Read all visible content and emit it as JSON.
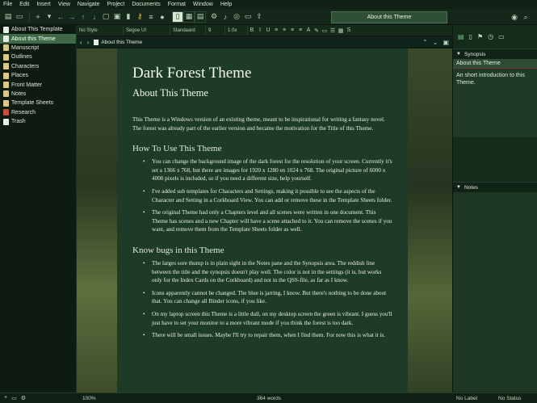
{
  "menu": [
    "File",
    "Edit",
    "Insert",
    "View",
    "Navigate",
    "Project",
    "Documents",
    "Format",
    "Window",
    "Help"
  ],
  "toolbar": {
    "title_tab": "About this Theme"
  },
  "binder": {
    "items": [
      {
        "label": "About This Template",
        "type": "doc"
      },
      {
        "label": "About this Theme",
        "type": "doc",
        "selected": true
      },
      {
        "label": "Manuscript",
        "type": "folder"
      },
      {
        "label": "Outlines",
        "type": "folder"
      },
      {
        "label": "Characters",
        "type": "folder"
      },
      {
        "label": "Places",
        "type": "folder"
      },
      {
        "label": "Front Matter",
        "type": "folder"
      },
      {
        "label": "Notes",
        "type": "folder"
      },
      {
        "label": "Template Sheets",
        "type": "folder"
      },
      {
        "label": "Research",
        "type": "folder"
      },
      {
        "label": "Trash",
        "type": "trash"
      }
    ]
  },
  "formatbar": {
    "style": "No Style",
    "font": "Segoe UI",
    "weight": "Standaard",
    "size": "9",
    "line_spacing": "1.0x"
  },
  "header": {
    "doc_title": "About this Theme"
  },
  "document": {
    "h1": "Dark Forest Theme",
    "h2": "About This Theme",
    "intro": "This Theme is a Windows version of an existing theme, meant to be inspirational for writing a fantasy novel. The forest was already part of the earlier version and became the motivation for the Title of this Theme.",
    "section1_title": "How To Use This Theme",
    "section1_items": [
      "You can change the background image of the dark forest for the resolution of your screen. Currently it's set a 1366 x 768, but there are images for 1920 x 1280 en 1024 x 768. The original picture of 6000 x 4000 pixels is included, so if you need a different size, help yourself.",
      "I've added sub templates for Characters and Settings, making it possible to see the aspects of the Character and Setting in a Corkboard View. You can add or remove these in the Template Sheets folder.",
      "The original Theme had only a Chapters level and all scenes were written in one document. This Theme has scenes and a new Chapter will have a scene attached to it. You can remove the scenes if you want, and remove them from the Template Sheets folder as well."
    ],
    "section2_title": "Know bugs in this Theme",
    "section2_items": [
      "The larges sore thump is in plain sight in the Notes pane and the Synopsis area. The reddish line between the title and the synopsis doesn't play well. The color is not in the settings (it is, but works only for the Index Cards on the Corkboard) and not in the QSS-file, as far as I know.",
      "Icons apparently cannot be changed. The blue is jarring, I know. But there's nothing to be done about that. You can change all Binder icons, if you like.",
      "On my laptop screen this Theme is a little dull, on my desktop screen the green is vibrant. I guess you'll just have to set your monitor to a more vibrant mode if you think the forest is too dark.",
      "There will be small issues. Maybe I'll try to repair them, when I find them. For now this is what it is."
    ]
  },
  "inspector": {
    "synopsis_label": "Synopsis",
    "synopsis_title": "About this Theme",
    "synopsis_text": "An short introduction to this Theme.",
    "notes_label": "Notes"
  },
  "footer": {
    "zoom": "100%",
    "words": "364 words",
    "label": "No Label",
    "status": "No Status"
  }
}
